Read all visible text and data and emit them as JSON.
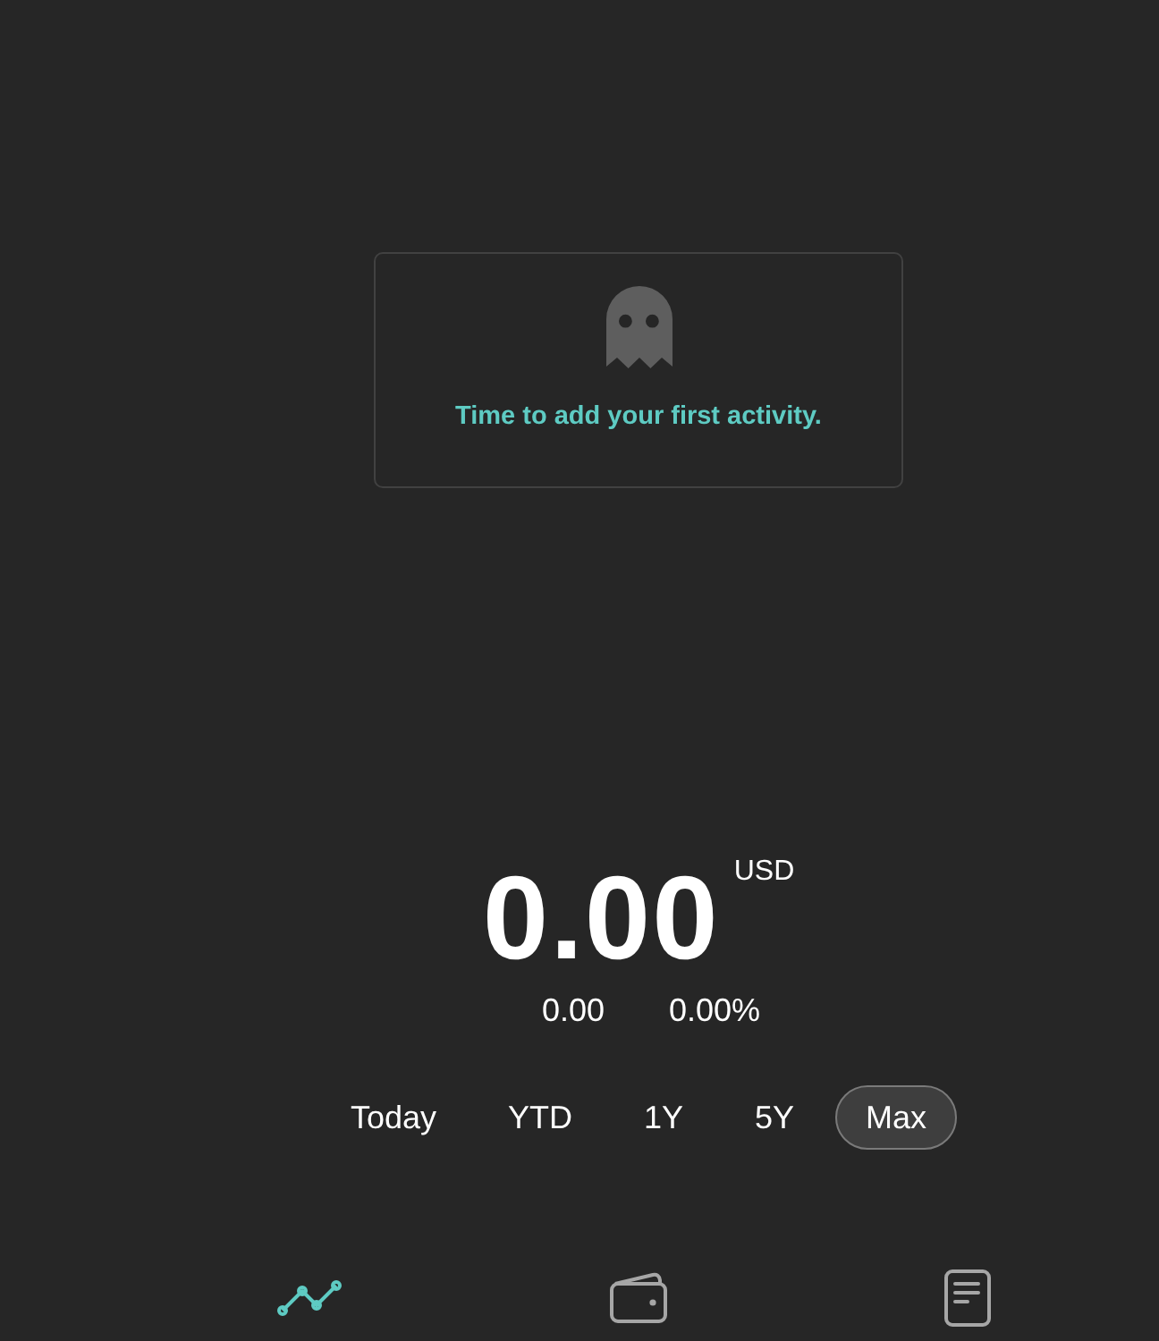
{
  "empty_state": {
    "message": "Time to add your first activity."
  },
  "portfolio": {
    "value": "0.00",
    "currency": "USD",
    "change": "0.00",
    "change_percent": "0.00%"
  },
  "ranges": [
    {
      "label": "Today",
      "selected": false
    },
    {
      "label": "YTD",
      "selected": false
    },
    {
      "label": "1Y",
      "selected": false
    },
    {
      "label": "5Y",
      "selected": false
    },
    {
      "label": "Max",
      "selected": true
    }
  ],
  "nav": [
    {
      "kind": "chart",
      "selected": true
    },
    {
      "kind": "wallet",
      "selected": false
    },
    {
      "kind": "document",
      "selected": false
    }
  ]
}
